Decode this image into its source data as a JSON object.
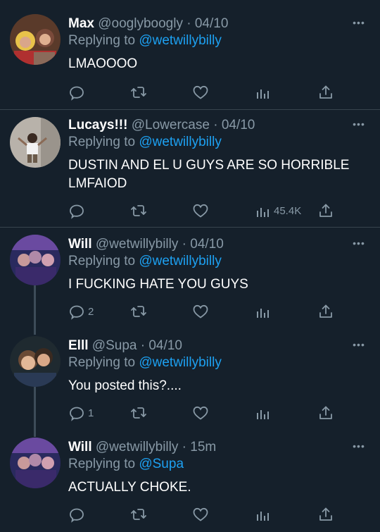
{
  "tweets": [
    {
      "name": "Max",
      "handle": "@ooglyboogly",
      "sep": "·",
      "time": "04/10",
      "replying_prefix": "Replying to ",
      "replying_to": "@wetwillybilly",
      "text": "LMAOOOO",
      "reply_count": "",
      "views": ""
    },
    {
      "name": "Lucays!!!",
      "handle": "@Lowercase",
      "sep": "·",
      "time": "04/10",
      "replying_prefix": "Replying to ",
      "replying_to": "@wetwillybilly",
      "text": "DUSTIN AND EL U GUYS ARE SO HORRIBLE LMFAIOD",
      "reply_count": "",
      "views": "45.4K"
    },
    {
      "name": "Will",
      "handle": "@wetwillybilly",
      "sep": "·",
      "time": "04/10",
      "replying_prefix": "Replying to ",
      "replying_to": "@wetwillybilly",
      "text": "I FUCKING HATE YOU GUYS",
      "reply_count": "2",
      "views": ""
    },
    {
      "name": "Elll",
      "handle": "@Supa",
      "sep": "·",
      "time": "04/10",
      "replying_prefix": "Replying to ",
      "replying_to": "@wetwillybilly",
      "text": "You posted this?....",
      "reply_count": "1",
      "views": ""
    },
    {
      "name": "Will",
      "handle": "@wetwillybilly",
      "sep": "·",
      "time": "15m",
      "replying_prefix": "Replying to ",
      "replying_to": "@Supa",
      "text": "ACTUALLY CHOKE.",
      "reply_count": "",
      "views": ""
    }
  ],
  "more_label": "•••",
  "icons": {
    "reply": "reply-icon",
    "retweet": "retweet-icon",
    "like": "like-icon",
    "views": "views-icon",
    "share": "share-icon"
  },
  "colors": {
    "background": "#15202b",
    "text": "#ffffff",
    "muted": "#8899a6",
    "link": "#1da1f2",
    "divider": "#38444d"
  }
}
